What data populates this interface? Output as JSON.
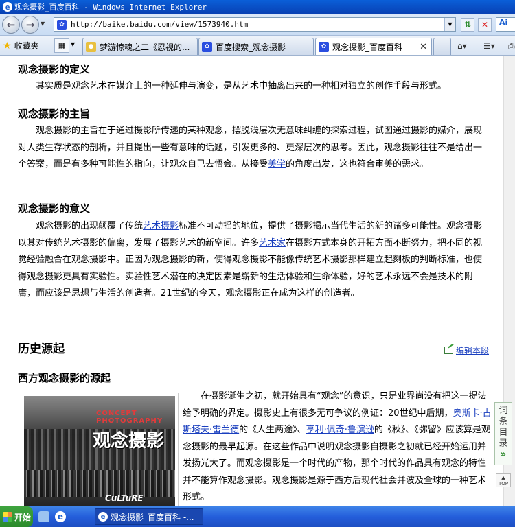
{
  "window": {
    "title": "观念摄影_百度百科 - Windows Internet Explorer"
  },
  "address": {
    "url": "http://baike.baidu.com/view/1573940.htm"
  },
  "toolbar": {
    "favorites_label": "收藏夹",
    "search_logo_text": "Ai"
  },
  "tabs": [
    {
      "label": "梦游惊魂之二《忍视的...",
      "icon_color": "#e8c040",
      "active": false
    },
    {
      "label": "百度搜索_观念摄影",
      "icon_color": "#2a4ee0",
      "active": false
    },
    {
      "label": "观念摄影_百度百科",
      "icon_color": "#2a4ee0",
      "active": true
    }
  ],
  "article": {
    "definition": {
      "heading": "观念摄影的定义",
      "text": "其实质是观念艺术在媒介上的一种延伸与演变，是从艺术中抽离出来的一种相对独立的创作手段与形式。"
    },
    "purpose": {
      "heading": "观念摄影的主旨",
      "text_a": "观念摄影的主旨在于通过摄影所传递的某种观念，摆脱浅层次无意味纠缠的探索过程，试图通过摄影的媒介，展现对人类生存状态的剖析，并且提出一些有意味的话题，引发更多的、更深层次的思考。因此，观念摄影往往不是给出一个答案，而是有多种可能性的指向，让观众自己去悟会。从接受",
      "link": "美学",
      "text_b": "的角度出发，这也符合审美的需求。"
    },
    "meaning": {
      "heading": "观念摄影的意义",
      "text_a": "观念摄影的出现颠覆了传统",
      "link_a": "艺术摄影",
      "text_b": "标准不可动摇的地位，提供了摄影揭示当代生活的新的诸多可能性。观念摄影以其对传统艺术摄影的偏离，发展了摄影艺术的新空间。许多",
      "link_b": "艺术家",
      "text_c": "在摄影方式本身的开拓方面不断努力，把不同的视觉经验融合在观念摄影中。正因为观念摄影的新，使得观念摄影不能像传统艺术摄影那样建立起刻板的判断标准，也使得观念摄影更具有实验性。实验性艺术潜在的决定因素是崭新的生活体验和生命体验，好的艺术永远不会是技术的附庸，而应该是思想与生活的创造者。21世纪的今天，观念摄影正在成为这样的创造者。"
    },
    "history": {
      "heading": "历史源起",
      "edit_label": "编辑本段",
      "sub_heading": "西方观念摄影的源起",
      "photo": {
        "title_en_1": "CONCEPT",
        "title_en_2": "PHOTOGRAPHY",
        "title_cn": "观念摄影",
        "brand": "CuLTuRE"
      },
      "text_a": "在摄影诞生之初，就开始具有“观念”的意识，只是业界尚没有把这一提法给予明确的界定。摄影史上有很多无可争议的例证：20世纪中后期，",
      "link_a": "奥斯卡·古斯塔夫·雷兰德",
      "text_b": "的《人生两途》、",
      "link_b": "亨利·佩奇·鲁滨逊",
      "text_c": "的《秋》、《弥留》应该算是观念摄影的最早起源。在这些作品中说明观念摄影自摄影之初就已经开始运用并发扬光大了。而观念摄影是一个时代的产物，那个时代的作品具有观念的特性并不能算作观念摄影。观念摄影是源于西方后现代社会并波及全球的一种艺术形式。"
    }
  },
  "widgets": {
    "toc_label": "词条目录",
    "toc_chevron": "»",
    "top_label": "TOP"
  },
  "taskbar": {
    "start_label": "开始",
    "task_label": "观念摄影_百度百科 -..."
  }
}
